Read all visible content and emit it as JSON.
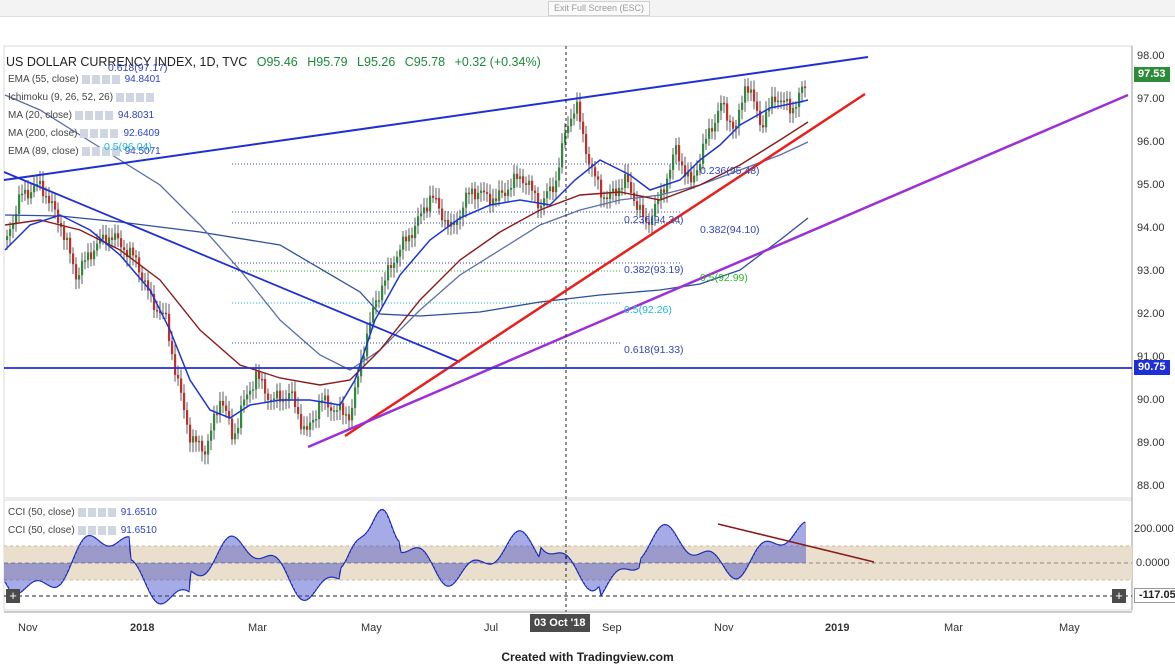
{
  "top_bar": {
    "exit_button": "Exit Full Screen (ESC)"
  },
  "header": {
    "symbol": "US DOLLAR CURRENCY INDEX, 1D, TVC",
    "open": "O95.46",
    "high": "H95.79",
    "low": "L95.26",
    "close": "C95.78",
    "change": "+0.32 (+0.34%)"
  },
  "indicators": [
    {
      "label": "EMA (55, close)",
      "value": "94.8401"
    },
    {
      "label": "Ichimoku (9, 26, 52, 26)",
      "value": ""
    },
    {
      "label": "MA (20, close)",
      "value": "94.8031"
    },
    {
      "label": "MA (200, close)",
      "value": "92.6409"
    },
    {
      "label": "EMA (89, close)",
      "value": "94.5071"
    }
  ],
  "cci": [
    {
      "label": "CCI (50, close)",
      "value": "91.6510"
    },
    {
      "label": "CCI (50, close)",
      "value": "91.6510"
    }
  ],
  "price_axis": [
    "98.00",
    "97.00",
    "96.00",
    "95.00",
    "94.00",
    "93.00",
    "92.00",
    "91.00",
    "90.00",
    "89.00",
    "88.00"
  ],
  "cci_axis": [
    "200.000",
    "0.0000",
    "-117.05"
  ],
  "price_tags": {
    "last": "97.53",
    "level": "90.75"
  },
  "time_axis": [
    "Nov",
    "2018",
    "Mar",
    "May",
    "Jul",
    "Sep",
    "Nov",
    "2019",
    "Mar",
    "May"
  ],
  "cursor_date": "03 Oct '18",
  "fib_labels": [
    "0.618(97.17)",
    "0.5(96.04)",
    "0.236(95.48)",
    "0.236(94.34)",
    "0.382(94.10)",
    "0.382(93.19)",
    "0.5(92.99)",
    "0.5(92.26)",
    "0.618(91.33)"
  ],
  "footer": "Created with Tradingview.com",
  "colors": {
    "trend_blue": "#1f2fd6",
    "trend_red": "#e8201c",
    "trend_purple": "#9b30d9",
    "ma20": "#1a34d6",
    "ema55": "#8b1a1a",
    "ma200": "#2c4f9c",
    "ema89": "#5a6fa8",
    "bull": "#2e8b3a",
    "bear": "#c92b26",
    "cci_fill": "#eadfcc"
  }
}
